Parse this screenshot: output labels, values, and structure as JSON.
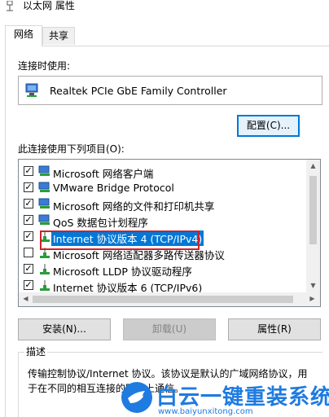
{
  "window": {
    "title": "以太网 属性"
  },
  "tabs": [
    {
      "label": "网络",
      "active": true
    },
    {
      "label": "共享",
      "active": false
    }
  ],
  "connect_using": {
    "label": "连接时使用:",
    "adapter": "Realtek PCIe GbE Family Controller",
    "configure_button": "配置(C)..."
  },
  "items_section": {
    "label": "此连接使用下列项目(O):",
    "items": [
      {
        "checked": true,
        "label": "Microsoft 网络客户端",
        "icon": "network-client-icon"
      },
      {
        "checked": true,
        "label": "VMware Bridge Protocol",
        "icon": "network-client-icon"
      },
      {
        "checked": true,
        "label": "Microsoft 网络的文件和打印机共享",
        "icon": "network-client-icon"
      },
      {
        "checked": true,
        "label": "QoS 数据包计划程序",
        "icon": "network-client-icon"
      },
      {
        "checked": true,
        "label": "Internet 协议版本 4 (TCP/IPv4)",
        "icon": "protocol-icon",
        "selected": true
      },
      {
        "checked": false,
        "label": "Microsoft 网络适配器多路传送器协议",
        "icon": "protocol-icon"
      },
      {
        "checked": true,
        "label": "Microsoft LLDP 协议驱动程序",
        "icon": "protocol-icon"
      },
      {
        "checked": true,
        "label": "Internet 协议版本 6 (TCP/IPv6)",
        "icon": "protocol-icon"
      }
    ]
  },
  "buttons": {
    "install": "安装(N)...",
    "uninstall": "卸载(U)",
    "properties": "属性(R)"
  },
  "description": {
    "title": "描述",
    "text": "传输控制协议/Internet 协议。该协议是默认的广域网络协议，用于在不同的相互连接的网络上通信。"
  },
  "watermark": {
    "title": "白云一键重装系统",
    "url": "www.baiyunxitong.com"
  },
  "colors": {
    "selection": "#0078d7",
    "highlight_frame": "#d0202a",
    "watermark": "#1e7be0"
  }
}
